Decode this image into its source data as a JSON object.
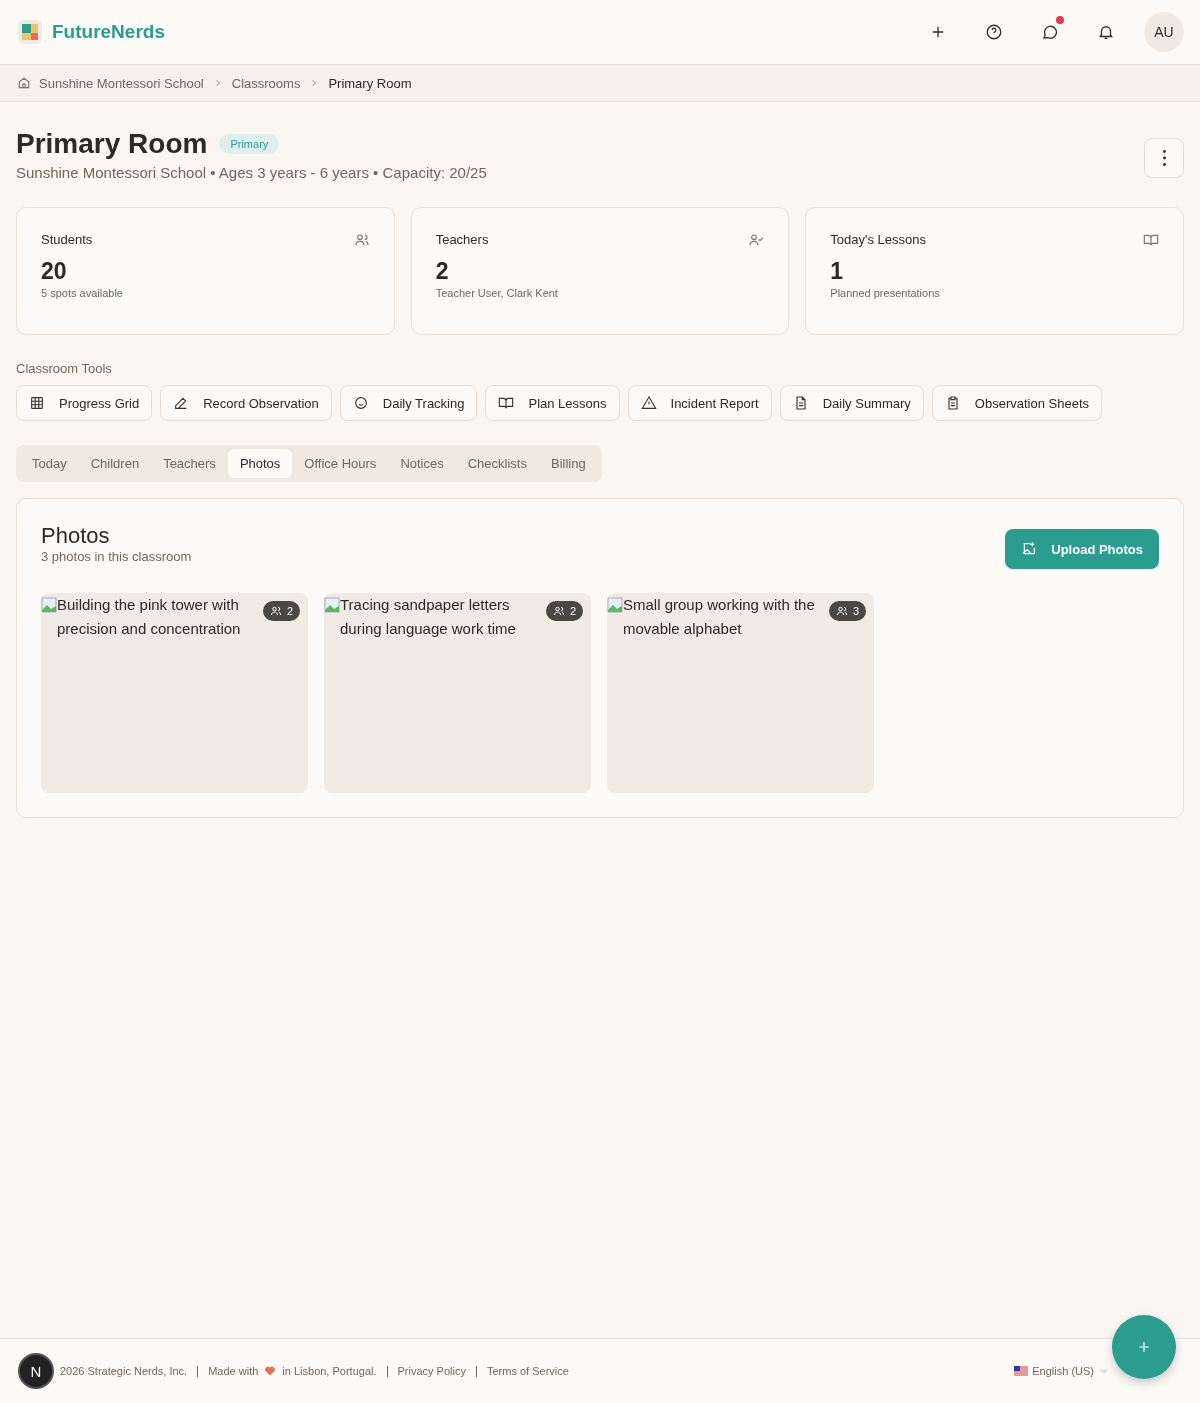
{
  "header": {
    "brand": "FutureNerds",
    "avatar": "AU",
    "messages_unread": true
  },
  "breadcrumb": [
    "Sunshine Montessori School",
    "Classrooms",
    "Primary Room"
  ],
  "page": {
    "title": "Primary Room",
    "badge": "Primary",
    "subtitle": "Sunshine Montessori School • Ages 3 years - 6 years • Capacity: 20/25"
  },
  "stats": [
    {
      "label": "Students",
      "value": "20",
      "note": "5 spots available",
      "kind": "users"
    },
    {
      "label": "Teachers",
      "value": "2",
      "note": "Teacher User, Clark Kent",
      "kind": "usercheck"
    },
    {
      "label": "Today's Lessons",
      "value": "1",
      "note": "Planned presentations",
      "kind": "book"
    }
  ],
  "tools": {
    "title": "Classroom Tools",
    "items": [
      {
        "label": "Progress Grid",
        "kind": "grid"
      },
      {
        "label": "Record Observation",
        "kind": "pen"
      },
      {
        "label": "Daily Tracking",
        "kind": "face"
      },
      {
        "label": "Plan Lessons",
        "kind": "book"
      },
      {
        "label": "Incident Report",
        "kind": "warning"
      },
      {
        "label": "Daily Summary",
        "kind": "document"
      },
      {
        "label": "Observation Sheets",
        "kind": "clipboard"
      }
    ]
  },
  "tabs": [
    {
      "label": "Today",
      "selected": false
    },
    {
      "label": "Children",
      "selected": false
    },
    {
      "label": "Teachers",
      "selected": false
    },
    {
      "label": "Photos",
      "selected": true
    },
    {
      "label": "Office Hours",
      "selected": false
    },
    {
      "label": "Notices",
      "selected": false
    },
    {
      "label": "Checklists",
      "selected": false
    },
    {
      "label": "Billing",
      "selected": false
    }
  ],
  "photos": {
    "title": "Photos",
    "subtitle": "3 photos in this classroom",
    "upload": "Upload Photos",
    "items": [
      {
        "alt": "Building the pink tower with precision and concentration",
        "count": "2"
      },
      {
        "alt": "Tracing sandpaper letters during language work time",
        "count": "2"
      },
      {
        "alt": "Small group working with the movable alphabet",
        "count": "3"
      }
    ]
  },
  "footer": {
    "logo": "N",
    "copyright": "2026 Strategic Nerds, Inc.",
    "made_with": "Made with",
    "location": "in Lisbon, Portugal.",
    "links": [
      "Privacy Policy",
      "Terms of Service"
    ],
    "language": "English (US)"
  }
}
